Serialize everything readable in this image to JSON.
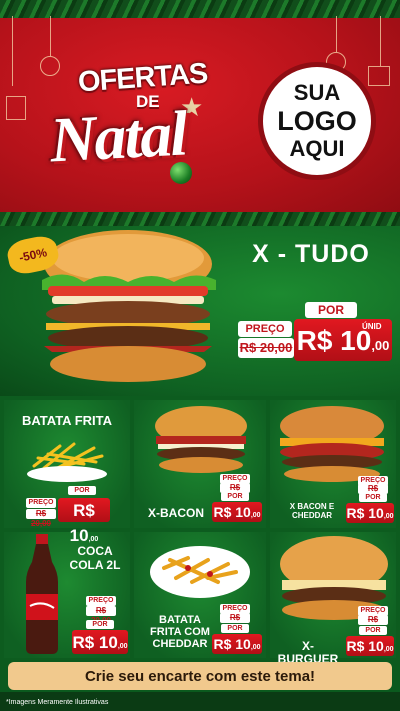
{
  "header": {
    "title_top": "OFERTAS",
    "title_de": "DE",
    "title_natal": "Natal",
    "logo_line1": "SUA",
    "logo_line2": "LOGO",
    "logo_line3": "AQUI"
  },
  "featured": {
    "name": "X - TUDO",
    "discount": "-50%",
    "por_label": "POR",
    "preco_label": "PREÇO",
    "old_price": "R$ 20,00",
    "new_price_main": "R$ 10",
    "new_price_cents": ",00",
    "unit": "ÚNID"
  },
  "items": [
    {
      "name": "BATATA FRITA",
      "preco_label": "PREÇO",
      "old_price": "R$ 20,00",
      "por_label": "POR",
      "new_price_main": "R$ 10",
      "new_price_cents": ",00"
    },
    {
      "name": "X-BACON",
      "preco_label": "PREÇO",
      "old_price": "R$ 20,00",
      "por_label": "POR",
      "new_price_main": "R$ 10",
      "new_price_cents": ",00"
    },
    {
      "name": "X BACON E CHEDDAR",
      "preco_label": "PREÇO",
      "old_price": "R$ 20,00",
      "por_label": "POR",
      "new_price_main": "R$ 10",
      "new_price_cents": ",00"
    },
    {
      "name": "COCA COLA 2L",
      "preco_label": "PREÇO",
      "old_price": "R$ 20,00",
      "por_label": "POR",
      "new_price_main": "R$ 10",
      "new_price_cents": ",00"
    },
    {
      "name": "BATATA FRITA COM CHEDDAR",
      "preco_label": "PREÇO",
      "old_price": "R$ 20,00",
      "por_label": "POR",
      "new_price_main": "R$ 10",
      "new_price_cents": ",00"
    },
    {
      "name": "X-BURGUER",
      "preco_label": "PREÇO",
      "old_price": "R$ 20,00",
      "por_label": "POR",
      "new_price_main": "R$ 10",
      "new_price_cents": ",00"
    }
  ],
  "cta": "Crie seu encarte com este tema!",
  "footnote": "*Imagens Meramente Ilustrativas",
  "colors": {
    "red": "#c0161d",
    "green": "#0f6122",
    "gold": "#f1c98d"
  }
}
